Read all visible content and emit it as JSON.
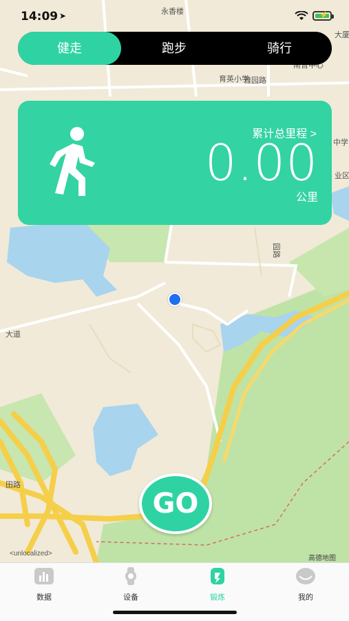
{
  "status_bar": {
    "time": "14:09",
    "location_arrow": "➤"
  },
  "mode_tabs": [
    {
      "label": "健走",
      "active": true
    },
    {
      "label": "跑步",
      "active": false
    },
    {
      "label": "骑行",
      "active": false
    }
  ],
  "summary_card": {
    "icon": "walking-person-icon",
    "total_link": "累计总里程 >",
    "distance": "0.00",
    "unit": "公里"
  },
  "map": {
    "labels": [
      "永香楼",
      "育英小学",
      "雅园路",
      "南普中心",
      "中学",
      "业区",
      "大厦",
      "大道",
      "田路",
      "园路"
    ],
    "unlocalized": "<unlocalized>",
    "credit": "高德地图"
  },
  "go_button": {
    "label": "GO"
  },
  "bottom_tabs": [
    {
      "label": "数据",
      "icon": "chart-icon",
      "active": false
    },
    {
      "label": "设备",
      "icon": "watch-icon",
      "active": false
    },
    {
      "label": "锻炼",
      "icon": "workout-icon",
      "active": true
    },
    {
      "label": "我的",
      "icon": "profile-icon",
      "active": false
    }
  ],
  "colors": {
    "accent": "#2fd3a3",
    "map_bg": "#f1ead8",
    "water": "#a8d4ee",
    "park": "#bfe3a6",
    "road_major": "#f5cf4a"
  }
}
